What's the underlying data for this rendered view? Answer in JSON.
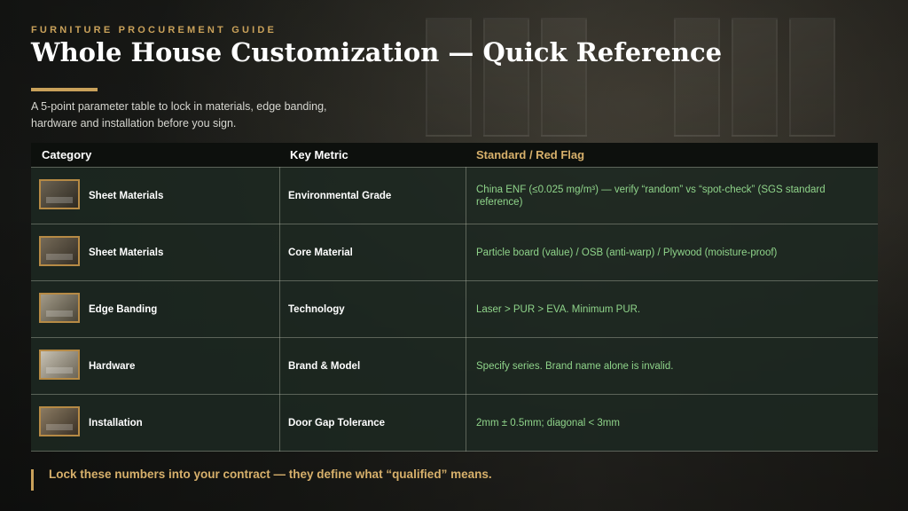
{
  "eyebrow": "FURNITURE PROCUREMENT GUIDE",
  "title": "Whole House Customization — Quick Reference",
  "subtitle": "A 5-point parameter table to lock in materials, edge banding, hardware and installation before you sign.",
  "table": {
    "headers": {
      "category": "Category",
      "metric": "Key Metric",
      "standard": "Standard / Red Flag"
    },
    "rows": [
      {
        "category": "Sheet Materials",
        "metric": "Environmental Grade",
        "standard": "China ENF (≤0.025 mg/m³) — verify “random” vs “spot-check” (SGS standard reference)",
        "thumb_icon": "factory-photo"
      },
      {
        "category": "Sheet Materials",
        "metric": "Core Material",
        "standard": "Particle board (value) / OSB (anti-warp) / Plywood (moisture-proof)",
        "thumb_icon": "factory-photo"
      },
      {
        "category": "Edge Banding",
        "metric": "Technology",
        "standard": "Laser > PUR > EVA. Minimum PUR.",
        "thumb_icon": "workshop-photo"
      },
      {
        "category": "Hardware",
        "metric": "Brand & Model",
        "standard": "Specify series. Brand name alone is invalid.",
        "thumb_icon": "hinge-photo"
      },
      {
        "category": "Installation",
        "metric": "Door Gap Tolerance",
        "standard": "2mm ± 0.5mm; diagonal < 3mm",
        "thumb_icon": "install-photo"
      }
    ]
  },
  "footer": "Lock these numbers into your contract — they define what “qualified” means.",
  "colors": {
    "accent": "#c9a15a",
    "standard_text": "#8fd48a",
    "header_standard": "#d7b06b"
  }
}
